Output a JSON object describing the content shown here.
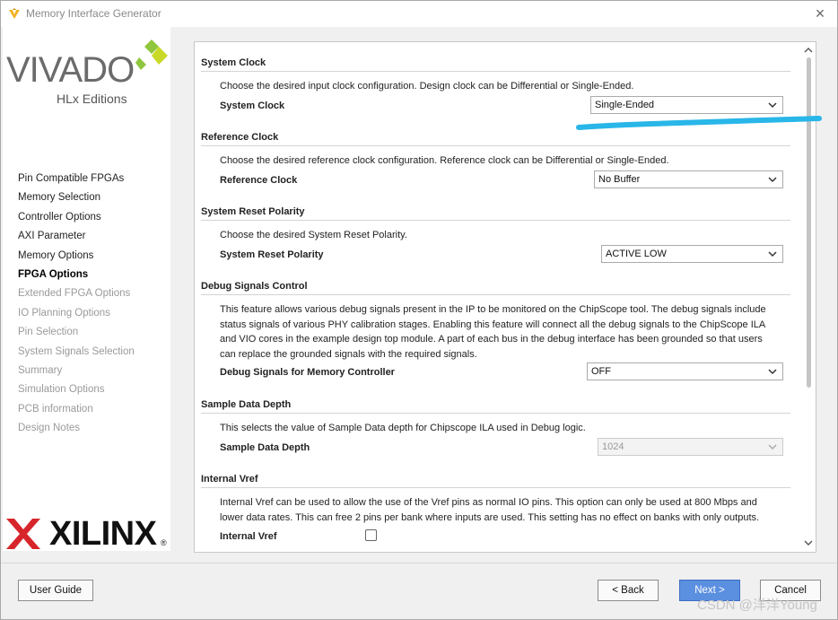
{
  "window": {
    "title": "Memory Interface Generator"
  },
  "branding": {
    "vivado": "VIVADO",
    "hlx": "HLx Editions",
    "xilinx": "XILINX",
    "registered": "®"
  },
  "nav": {
    "items": [
      {
        "label": "Pin Compatible FPGAs",
        "state": "done"
      },
      {
        "label": "Memory Selection",
        "state": "done"
      },
      {
        "label": "Controller Options",
        "state": "done"
      },
      {
        "label": "AXI Parameter",
        "state": "done"
      },
      {
        "label": "Memory Options",
        "state": "done"
      },
      {
        "label": "FPGA Options",
        "state": "active"
      },
      {
        "label": "Extended FPGA Options",
        "state": "todo"
      },
      {
        "label": "IO Planning Options",
        "state": "todo"
      },
      {
        "label": "Pin Selection",
        "state": "todo"
      },
      {
        "label": "System Signals Selection",
        "state": "todo"
      },
      {
        "label": "Summary",
        "state": "todo"
      },
      {
        "label": "Simulation Options",
        "state": "todo"
      },
      {
        "label": "PCB information",
        "state": "todo"
      },
      {
        "label": "Design Notes",
        "state": "todo"
      }
    ]
  },
  "sections": {
    "system_clock": {
      "title": "System Clock",
      "desc": "Choose the desired input clock configuration. Design clock can be Differential or Single-Ended.",
      "label": "System Clock",
      "value": "Single-Ended"
    },
    "reference_clock": {
      "title": "Reference Clock",
      "desc": "Choose the desired reference clock configuration. Reference clock can be Differential or Single-Ended.",
      "label": "Reference Clock",
      "value": "No Buffer"
    },
    "reset_polarity": {
      "title": "System Reset Polarity",
      "desc": "Choose the desired System Reset Polarity.",
      "label": "System Reset Polarity",
      "value": "ACTIVE LOW"
    },
    "debug": {
      "title": "Debug Signals Control",
      "desc_lines": [
        "This feature allows various debug signals present in the IP to be monitored on the ChipScope tool. The debug signals include",
        "status signals of various PHY calibration stages. Enabling this feature will connect all the debug signals to the ChipScope ILA",
        "and VIO cores in the example design top module. A part of each bus in the debug interface has been grounded so that users",
        "can replace the grounded signals with the required signals."
      ],
      "label": "Debug Signals for Memory Controller",
      "value": "OFF"
    },
    "sample_depth": {
      "title": "Sample Data Depth",
      "desc": "This selects the value of Sample Data depth for Chipscope ILA used in Debug logic.",
      "label": "Sample Data Depth",
      "value": "1024"
    },
    "vref": {
      "title": "Internal Vref",
      "desc_lines": [
        "Internal Vref can be used to allow the use of the Vref pins as normal IO pins. This option can only be used at 800 Mbps and",
        "lower data rates. This can free 2 pins per bank where inputs are used. This setting has no effect on banks with only outputs."
      ],
      "label": "Internal Vref",
      "checked": false
    }
  },
  "footer": {
    "user_guide": "User Guide",
    "back": "< Back",
    "next": "Next >",
    "cancel": "Cancel"
  },
  "watermark": "CSDN @洋洋Young",
  "colors": {
    "accent": "#5b8fe0",
    "annotation": "#29b6e8"
  }
}
